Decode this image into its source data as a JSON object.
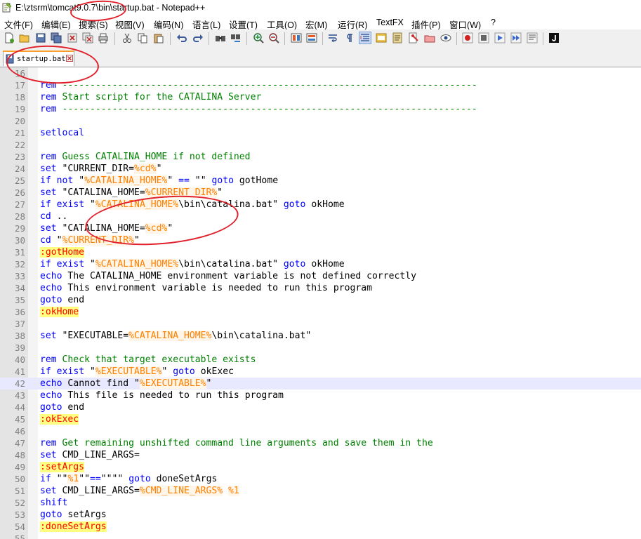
{
  "window": {
    "title": "E:\\ztsrm\\tomcat9.0.7\\bin\\startup.bat - Notepad++"
  },
  "menu": [
    {
      "label": "文件(F)"
    },
    {
      "label": "编辑(E)"
    },
    {
      "label": "搜索(S)"
    },
    {
      "label": "视图(V)"
    },
    {
      "label": "编码(N)"
    },
    {
      "label": "语言(L)"
    },
    {
      "label": "设置(T)"
    },
    {
      "label": "工具(O)"
    },
    {
      "label": "宏(M)"
    },
    {
      "label": "运行(R)"
    },
    {
      "label": "TextFX"
    },
    {
      "label": "插件(P)"
    },
    {
      "label": "窗口(W)"
    },
    {
      "label": "?"
    }
  ],
  "toolbar_icons": [
    "new-file-icon",
    "open-file-icon",
    "save-icon",
    "save-all-icon",
    "close-icon",
    "close-all-icon",
    "print-icon",
    "cut-icon",
    "copy-icon",
    "paste-icon",
    "undo-icon",
    "redo-icon",
    "find-icon",
    "replace-icon",
    "zoom-in-icon",
    "zoom-out-icon",
    "sync-vertical-icon",
    "sync-horizontal-icon",
    "word-wrap-icon",
    "show-all-chars-icon",
    "indent-guide-icon",
    "language-icon",
    "function-list-icon",
    "document-map-icon",
    "folder-workspace-icon",
    "monitor-icon",
    "record-macro-icon",
    "stop-macro-icon",
    "play-macro-icon",
    "run-macro-multiple-icon",
    "save-macro-icon",
    "jsl-icon"
  ],
  "colors": {
    "keyword": "#0000ff",
    "comment": "#008000",
    "variable": "#ff8000",
    "label": "#ff0000",
    "annotation": "#e0202a",
    "current_line": "#e8e8ff"
  },
  "tab": {
    "label": "startup.bat"
  },
  "editor": {
    "current_line": 42,
    "lines": [
      {
        "n": "16",
        "segs": []
      },
      {
        "n": "17",
        "segs": [
          {
            "c": "kw",
            "t": "rem"
          },
          {
            "c": "cm",
            "t": " ---------------------------------------------------------------------------"
          }
        ]
      },
      {
        "n": "18",
        "segs": [
          {
            "c": "kw",
            "t": "rem"
          },
          {
            "c": "cm",
            "t": " Start script for the CATALINA Server"
          }
        ]
      },
      {
        "n": "19",
        "segs": [
          {
            "c": "kw",
            "t": "rem"
          },
          {
            "c": "cm",
            "t": " ---------------------------------------------------------------------------"
          }
        ]
      },
      {
        "n": "20",
        "segs": []
      },
      {
        "n": "21",
        "segs": [
          {
            "c": "kw",
            "t": "setlocal"
          }
        ]
      },
      {
        "n": "22",
        "segs": []
      },
      {
        "n": "23",
        "segs": [
          {
            "c": "kw",
            "t": "rem"
          },
          {
            "c": "cm",
            "t": " Guess CATALINA_HOME if not defined"
          }
        ]
      },
      {
        "n": "24",
        "segs": [
          {
            "c": "kw",
            "t": "set"
          },
          {
            "c": "tx",
            "t": " \"CURRENT_DIR="
          },
          {
            "c": "vr",
            "t": "%cd%"
          },
          {
            "c": "tx",
            "t": "\""
          }
        ]
      },
      {
        "n": "25",
        "segs": [
          {
            "c": "kw",
            "t": "if"
          },
          {
            "c": "tx",
            "t": " "
          },
          {
            "c": "kw",
            "t": "not"
          },
          {
            "c": "tx",
            "t": " \""
          },
          {
            "c": "vr",
            "t": "%CATALINA_HOME%"
          },
          {
            "c": "tx",
            "t": "\" "
          },
          {
            "c": "kw",
            "t": "=="
          },
          {
            "c": "tx",
            "t": " \"\" "
          },
          {
            "c": "kw",
            "t": "goto"
          },
          {
            "c": "tx",
            "t": " gotHome"
          }
        ]
      },
      {
        "n": "26",
        "segs": [
          {
            "c": "kw",
            "t": "set"
          },
          {
            "c": "tx",
            "t": " \"CATALINA_HOME="
          },
          {
            "c": "vr",
            "t": "%CURRENT_DIR%"
          },
          {
            "c": "tx",
            "t": "\""
          }
        ]
      },
      {
        "n": "27",
        "segs": [
          {
            "c": "kw",
            "t": "if"
          },
          {
            "c": "tx",
            "t": " "
          },
          {
            "c": "kw",
            "t": "exist"
          },
          {
            "c": "tx",
            "t": " \""
          },
          {
            "c": "vr",
            "t": "%CATALINA_HOME%"
          },
          {
            "c": "tx",
            "t": "\\bin\\catalina.bat\" "
          },
          {
            "c": "kw",
            "t": "goto"
          },
          {
            "c": "tx",
            "t": " okHome"
          }
        ]
      },
      {
        "n": "28",
        "segs": [
          {
            "c": "kw",
            "t": "cd"
          },
          {
            "c": "tx",
            "t": " .."
          }
        ]
      },
      {
        "n": "29",
        "segs": [
          {
            "c": "kw",
            "t": "set"
          },
          {
            "c": "tx",
            "t": " \"CATALINA_HOME="
          },
          {
            "c": "vr",
            "t": "%cd%"
          },
          {
            "c": "tx",
            "t": "\""
          }
        ]
      },
      {
        "n": "30",
        "segs": [
          {
            "c": "kw",
            "t": "cd"
          },
          {
            "c": "tx",
            "t": " \""
          },
          {
            "c": "vr",
            "t": "%CURRENT_DIR%"
          },
          {
            "c": "tx",
            "t": "\""
          }
        ]
      },
      {
        "n": "31",
        "segs": [
          {
            "c": "lb",
            "t": ":gotHome"
          }
        ]
      },
      {
        "n": "32",
        "segs": [
          {
            "c": "kw",
            "t": "if"
          },
          {
            "c": "tx",
            "t": " "
          },
          {
            "c": "kw",
            "t": "exist"
          },
          {
            "c": "tx",
            "t": " \""
          },
          {
            "c": "vr",
            "t": "%CATALINA_HOME%"
          },
          {
            "c": "tx",
            "t": "\\bin\\catalina.bat\" "
          },
          {
            "c": "kw",
            "t": "goto"
          },
          {
            "c": "tx",
            "t": " okHome"
          }
        ]
      },
      {
        "n": "33",
        "segs": [
          {
            "c": "kw",
            "t": "echo"
          },
          {
            "c": "tx",
            "t": " The CATALINA_HOME environment variable is not defined correctly"
          }
        ]
      },
      {
        "n": "34",
        "segs": [
          {
            "c": "kw",
            "t": "echo"
          },
          {
            "c": "tx",
            "t": " This environment variable is needed to run this program"
          }
        ]
      },
      {
        "n": "35",
        "segs": [
          {
            "c": "kw",
            "t": "goto"
          },
          {
            "c": "tx",
            "t": " end"
          }
        ]
      },
      {
        "n": "36",
        "segs": [
          {
            "c": "lb",
            "t": ":okHome"
          }
        ]
      },
      {
        "n": "37",
        "segs": []
      },
      {
        "n": "38",
        "segs": [
          {
            "c": "kw",
            "t": "set"
          },
          {
            "c": "tx",
            "t": " \"EXECUTABLE="
          },
          {
            "c": "vr",
            "t": "%CATALINA_HOME%"
          },
          {
            "c": "tx",
            "t": "\\bin\\catalina.bat\""
          }
        ]
      },
      {
        "n": "39",
        "segs": []
      },
      {
        "n": "40",
        "segs": [
          {
            "c": "kw",
            "t": "rem"
          },
          {
            "c": "cm",
            "t": " Check that target executable exists"
          }
        ]
      },
      {
        "n": "41",
        "segs": [
          {
            "c": "kw",
            "t": "if"
          },
          {
            "c": "tx",
            "t": " "
          },
          {
            "c": "kw",
            "t": "exist"
          },
          {
            "c": "tx",
            "t": " \""
          },
          {
            "c": "vr",
            "t": "%EXECUTABLE%"
          },
          {
            "c": "tx",
            "t": "\" "
          },
          {
            "c": "kw",
            "t": "goto"
          },
          {
            "c": "tx",
            "t": " okExec"
          }
        ]
      },
      {
        "n": "42",
        "segs": [
          {
            "c": "kw",
            "t": "echo"
          },
          {
            "c": "tx",
            "t": " Cannot find \""
          },
          {
            "c": "vr",
            "t": "%EXECUTABLE%"
          },
          {
            "c": "tx",
            "t": "\""
          }
        ]
      },
      {
        "n": "43",
        "segs": [
          {
            "c": "kw",
            "t": "echo"
          },
          {
            "c": "tx",
            "t": " This file is needed to run this program"
          }
        ]
      },
      {
        "n": "44",
        "segs": [
          {
            "c": "kw",
            "t": "goto"
          },
          {
            "c": "tx",
            "t": " end"
          }
        ]
      },
      {
        "n": "45",
        "segs": [
          {
            "c": "lb",
            "t": ":okExec"
          }
        ]
      },
      {
        "n": "46",
        "segs": []
      },
      {
        "n": "47",
        "segs": [
          {
            "c": "kw",
            "t": "rem"
          },
          {
            "c": "cm",
            "t": " Get remaining unshifted command line arguments and save them in the"
          }
        ]
      },
      {
        "n": "48",
        "segs": [
          {
            "c": "kw",
            "t": "set"
          },
          {
            "c": "tx",
            "t": " CMD_LINE_ARGS="
          }
        ]
      },
      {
        "n": "49",
        "segs": [
          {
            "c": "lb",
            "t": ":setArgs"
          }
        ]
      },
      {
        "n": "50",
        "segs": [
          {
            "c": "kw",
            "t": "if"
          },
          {
            "c": "tx",
            "t": " \"\""
          },
          {
            "c": "vr",
            "t": "%1"
          },
          {
            "c": "tx",
            "t": "\"\""
          },
          {
            "c": "kw",
            "t": "=="
          },
          {
            "c": "tx",
            "t": "\"\"\"\" "
          },
          {
            "c": "kw",
            "t": "goto"
          },
          {
            "c": "tx",
            "t": " doneSetArgs"
          }
        ]
      },
      {
        "n": "51",
        "segs": [
          {
            "c": "kw",
            "t": "set"
          },
          {
            "c": "tx",
            "t": " CMD_LINE_ARGS="
          },
          {
            "c": "vr",
            "t": "%CMD_LINE_ARGS%"
          },
          {
            "c": "tx",
            "t": " "
          },
          {
            "c": "vr",
            "t": "%1"
          }
        ]
      },
      {
        "n": "52",
        "segs": [
          {
            "c": "kw",
            "t": "shift"
          }
        ]
      },
      {
        "n": "53",
        "segs": [
          {
            "c": "kw",
            "t": "goto"
          },
          {
            "c": "tx",
            "t": " setArgs"
          }
        ]
      },
      {
        "n": "54",
        "segs": [
          {
            "c": "lb",
            "t": ":doneSetArgs"
          }
        ]
      },
      {
        "n": "55",
        "segs": []
      }
    ]
  }
}
